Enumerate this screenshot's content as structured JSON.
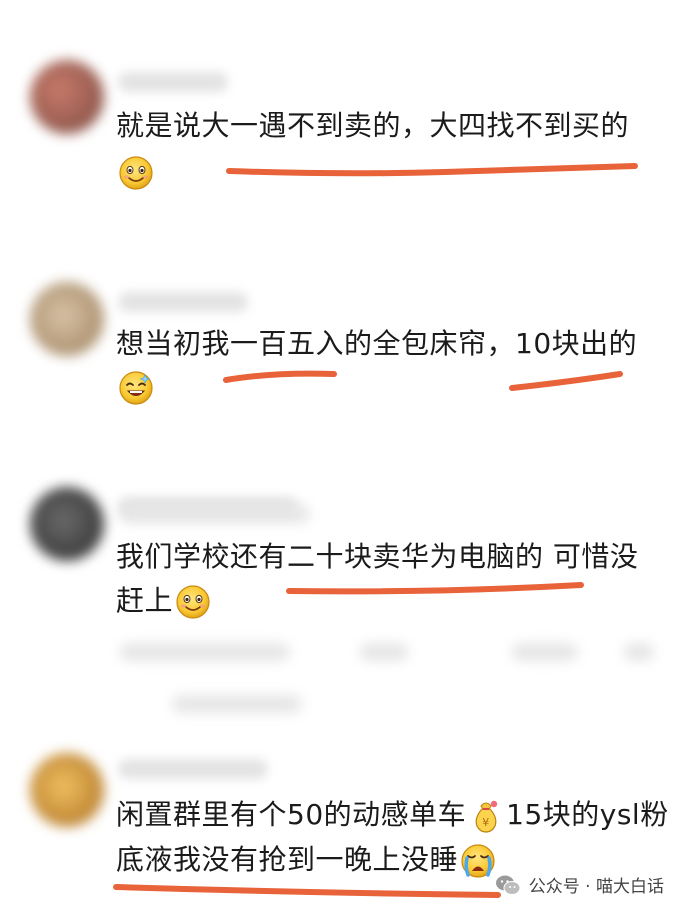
{
  "comments": [
    {
      "line1": "就是说大一遇不到卖的，大四找不到买的",
      "emoji": "smile-emoji-icon"
    },
    {
      "line1": "想当初我一百五入的全包床帘，10块出的",
      "emoji": "grin-sparkle-emoji-icon"
    },
    {
      "line1": "我们学校还有二十块卖华为电脑的 可惜没",
      "line2": "赶上",
      "emoji": "smile-emoji-icon"
    },
    {
      "line1_a": "闲置群里有个50的动感单车",
      "line1_b": "15块的ysl粉",
      "line2": "底液我没有抢到一晚上没睡",
      "emoji_mid": "money-bag-emoji-icon",
      "emoji_end": "crying-emoji-icon"
    }
  ],
  "watermark": {
    "label": "公众号 · 喵大白话",
    "icon": "wechat-icon"
  },
  "colors": {
    "underline": "#e8623a",
    "emoji_face": "#fcd34d",
    "text": "#1b1b1b"
  }
}
